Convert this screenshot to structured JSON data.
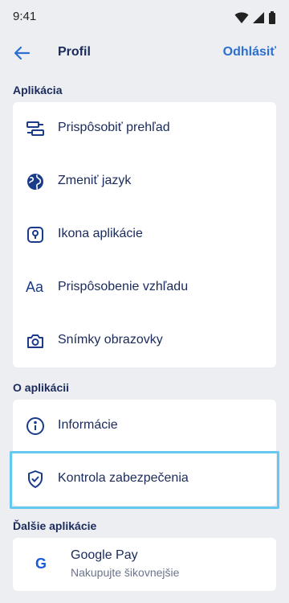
{
  "status_bar": {
    "time": "9:41"
  },
  "header": {
    "title": "Profil",
    "logout_label": "Odhlásiť"
  },
  "sections": {
    "app": {
      "label": "Aplikácia",
      "items": [
        {
          "label": "Prispôsobiť prehľad",
          "icon": "layout-icon"
        },
        {
          "label": "Zmeniť jazyk",
          "icon": "globe-icon"
        },
        {
          "label": "Ikona aplikácie",
          "icon": "app-icon"
        },
        {
          "label": "Prispôsobenie vzhľadu",
          "icon": "font-aa-icon",
          "icon_text": "Aa"
        },
        {
          "label": "Snímky obrazovky",
          "icon": "camera-icon"
        }
      ]
    },
    "about": {
      "label": "O aplikácii",
      "items": [
        {
          "label": "Informácie",
          "icon": "info-icon"
        },
        {
          "label": "Kontrola zabezpečenia",
          "icon": "shield-check-icon"
        }
      ]
    },
    "other_apps": {
      "label": "Ďalšie aplikácie",
      "items": [
        {
          "title": "Google Pay",
          "subtitle": "Nakupujte šikovnejšie",
          "icon": "google-g-icon",
          "icon_text": "G"
        }
      ]
    }
  },
  "colors": {
    "background": "#eceef2",
    "card": "#ffffff",
    "text": "#1a2a5a",
    "accent": "#2c6fd1",
    "highlight_border": "#66c8ee",
    "subtitle": "#6b7489"
  }
}
